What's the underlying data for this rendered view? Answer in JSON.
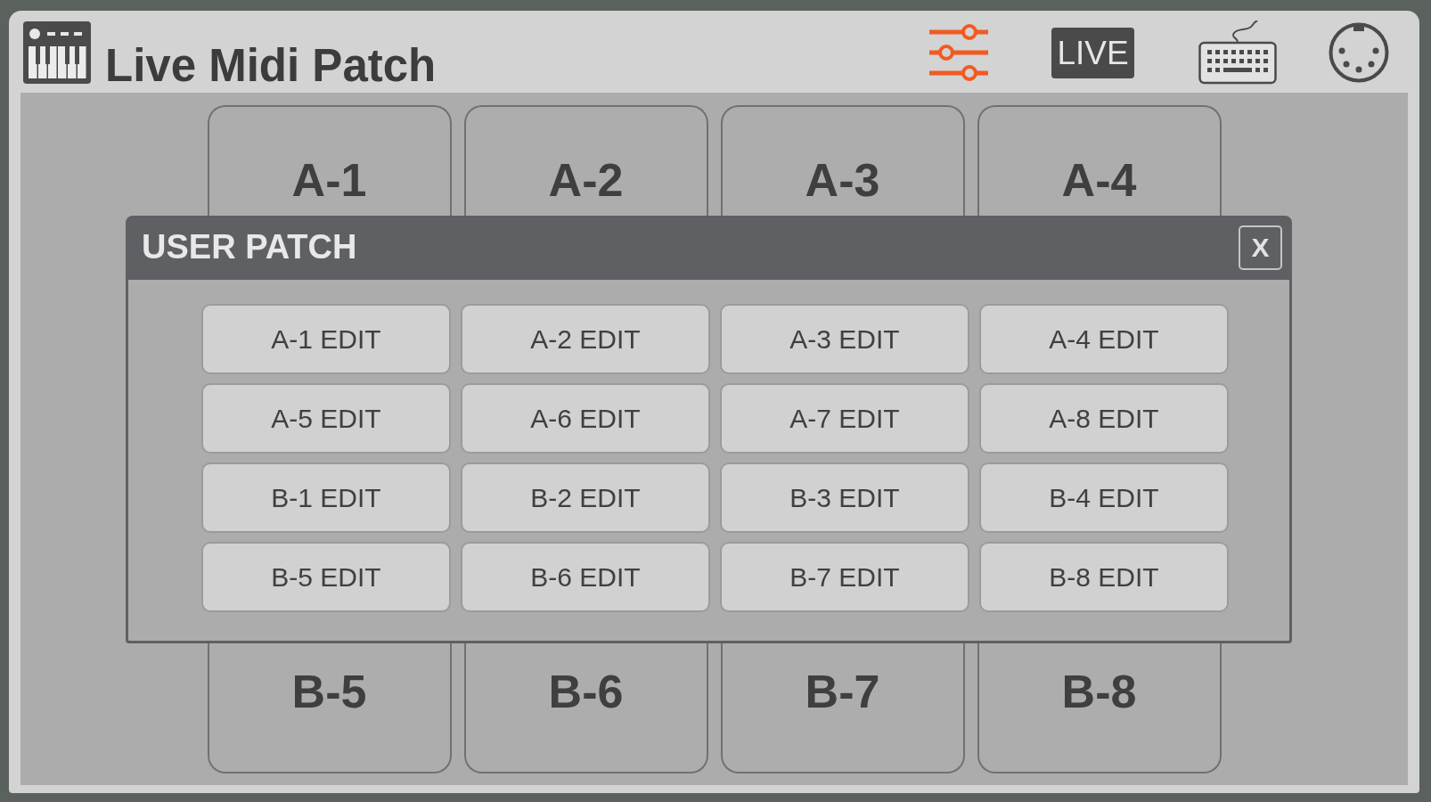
{
  "app": {
    "title": "Live Midi Patch"
  },
  "toolbar": [
    {
      "kind": "mixer",
      "selected": true
    },
    {
      "kind": "live",
      "label": "LIVE",
      "selected": false
    },
    {
      "kind": "keyboard",
      "selected": false
    },
    {
      "kind": "midi-port",
      "selected": false
    }
  ],
  "pads": {
    "top_row": [
      "A-1",
      "A-2",
      "A-3",
      "A-4"
    ],
    "bottom_row": [
      "B-5",
      "B-6",
      "B-7",
      "B-8"
    ]
  },
  "dialog": {
    "title": "USER PATCH",
    "close_label": "X",
    "buttons": [
      "A-1 EDIT",
      "A-2 EDIT",
      "A-3 EDIT",
      "A-4 EDIT",
      "A-5 EDIT",
      "A-6 EDIT",
      "A-7 EDIT",
      "A-8 EDIT",
      "B-1 EDIT",
      "B-2 EDIT",
      "B-3 EDIT",
      "B-4 EDIT",
      "B-5 EDIT",
      "B-6 EDIT",
      "B-7 EDIT",
      "B-8 EDIT"
    ]
  }
}
